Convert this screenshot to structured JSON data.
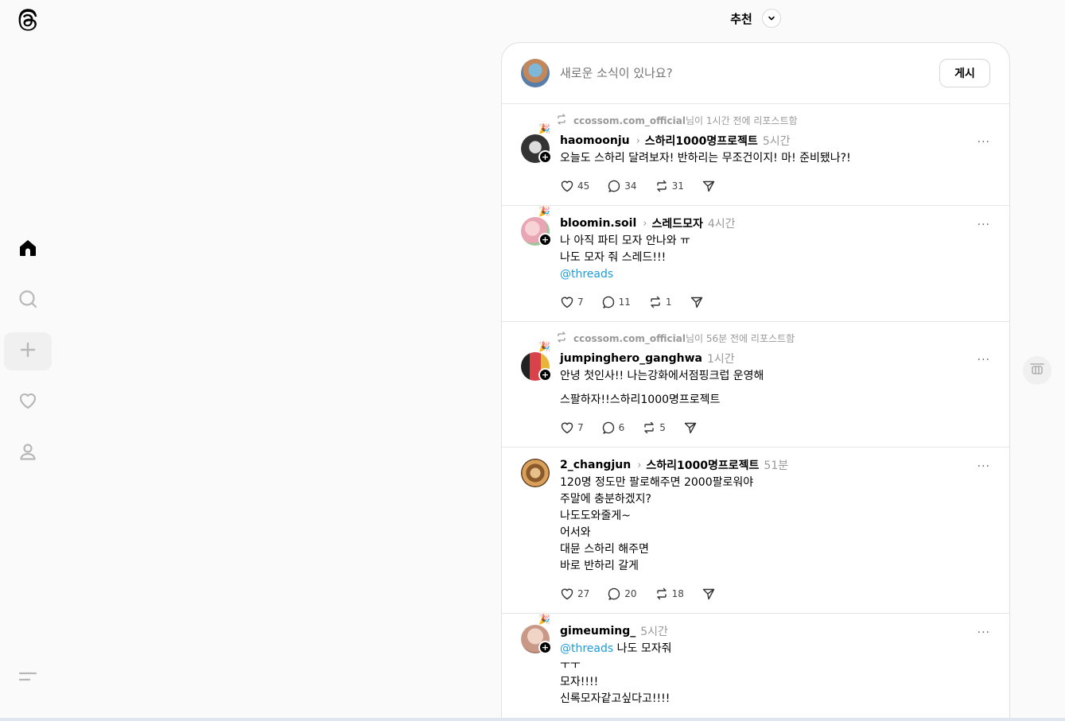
{
  "header": {
    "feed_label": "추천"
  },
  "composer": {
    "placeholder": "새로운 소식이 있나요?",
    "post_label": "게시"
  },
  "posts": [
    {
      "repost": {
        "user": "ccossom.com_official",
        "suffix": "님이 1시간 전에 리포스트함"
      },
      "username": "haomoonju",
      "topic": "스하리1000명프로젝트",
      "time": "5시간",
      "lines": [
        "오늘도 스하리 달려보자! 반하리는 무조건이지! 마! 준비됐나?!"
      ],
      "likes": "45",
      "replies": "34",
      "reposts": "31"
    },
    {
      "username": "bloomin.soil",
      "topic": "스레드모자",
      "time": "4시간",
      "line1": "나 아직 파티 모자 안나와 ㅠ",
      "line2": "나도 모자 줘 스레드!!!",
      "mention": "@threads",
      "likes": "7",
      "replies": "11",
      "reposts": "1"
    },
    {
      "repost": {
        "user": "ccossom.com_official",
        "suffix": "님이 56분 전에 리포스트함"
      },
      "username": "jumpinghero_ganghwa",
      "time": "1시간",
      "line1": "안녕 첫인사!! 나는강화에서점핑크럽 운영해",
      "line2": "스팔하자!!스하리1000명프로젝트",
      "likes": "7",
      "replies": "6",
      "reposts": "5"
    },
    {
      "username": "2_changjun",
      "topic": "스하리1000명프로젝트",
      "time": "51분",
      "text": "120명 정도만 팔로해주면 2000팔로워야\n주말에 충분하겠지?\n나도도와줄게~\n어서와\n대뮨 스하리 해주면\n바로 반하리 갈게",
      "likes": "27",
      "replies": "20",
      "reposts": "18"
    },
    {
      "username": "gimeuming_",
      "time": "5시간",
      "mention": "@threads",
      "after_mention": " 나도 모자줘",
      "text": "ㅜㅜ\n모자!!!!\n신록모자같고싶다고!!!!"
    }
  ],
  "colors": {
    "mention": "#1d9bd8",
    "muted": "#999999",
    "background": "#fafafa"
  },
  "icons": [
    "threads-logo-icon",
    "home-icon",
    "search-icon",
    "plus-icon",
    "heart-icon",
    "profile-icon",
    "menu-icon",
    "chevron-down-icon",
    "more-icon",
    "like-icon",
    "reply-icon",
    "repost-icon",
    "share-icon",
    "scroll-top-icon"
  ]
}
